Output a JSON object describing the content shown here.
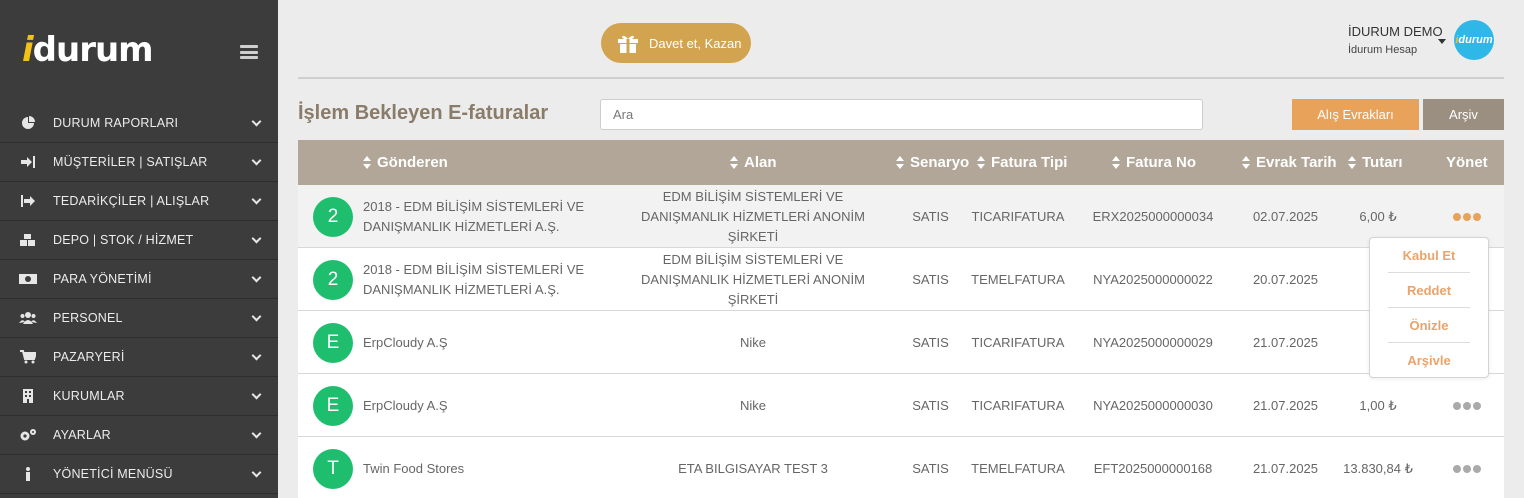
{
  "sidebar": {
    "logo_prefix": "i",
    "logo_rest": "durum",
    "items": [
      {
        "label": "DURUM RAPORLARI",
        "icon": "pie-chart-icon"
      },
      {
        "label": "MÜŞTERİLER | SATIŞLAR",
        "icon": "sign-in-icon"
      },
      {
        "label": "TEDARİKÇİLER | ALIŞLAR",
        "icon": "sign-out-icon"
      },
      {
        "label": "DEPO | STOK / HİZMET",
        "icon": "cubes-icon"
      },
      {
        "label": "PARA YÖNETİMİ",
        "icon": "money-icon"
      },
      {
        "label": "PERSONEL",
        "icon": "users-icon"
      },
      {
        "label": "PAZARYERİ",
        "icon": "cart-icon"
      },
      {
        "label": "KURUMLAR",
        "icon": "building-icon"
      },
      {
        "label": "AYARLAR",
        "icon": "cogs-icon"
      },
      {
        "label": "YÖNETİCİ MENÜSÜ",
        "icon": "info-icon"
      }
    ]
  },
  "header": {
    "invite_label": "Davet et, Kazan",
    "user_name": "İDURUM DEMO",
    "user_sub": "İdurum Hesap",
    "avatar_prefix": "i",
    "avatar_rest": "durum"
  },
  "page": {
    "title": "İşlem Bekleyen E-faturalar",
    "search_placeholder": "Ara",
    "btn_alis": "Alış Evrakları",
    "btn_arsiv": "Arşiv"
  },
  "table": {
    "columns": {
      "sender": "Gönderen",
      "alan": "Alan",
      "senaryo": "Senaryo",
      "tip": "Fatura Tipi",
      "no": "Fatura No",
      "tarih": "Evrak Tarih",
      "tutar": "Tutarı",
      "yonet": "Yönet"
    },
    "rows": [
      {
        "initial": "2",
        "sender": "2018 - EDM BİLİŞİM SİSTEMLERİ VE DANIŞMANLIK HİZMETLERİ A.Ş.",
        "alan": "EDM BİLİŞİM SİSTEMLERİ VE DANIŞMANLIK HİZMETLERİ ANONİM ŞİRKETİ",
        "senaryo": "SATIS",
        "tip": "TICARIFATURA",
        "no": "ERX2025000000034",
        "tarih": "02.07.2025",
        "tutar": "6,00 ₺"
      },
      {
        "initial": "2",
        "sender": "2018 - EDM BİLİŞİM SİSTEMLERİ VE DANIŞMANLIK HİZMETLERİ A.Ş.",
        "alan": "EDM BİLİŞİM SİSTEMLERİ VE DANIŞMANLIK HİZMETLERİ ANONİM ŞİRKETİ",
        "senaryo": "SATIS",
        "tip": "TEMELFATURA",
        "no": "NYA2025000000022",
        "tarih": "20.07.2025",
        "tutar": "33,"
      },
      {
        "initial": "E",
        "sender": "ErpCloudy A.Ş",
        "alan": "Nike",
        "senaryo": "SATIS",
        "tip": "TICARIFATURA",
        "no": "NYA2025000000029",
        "tarih": "21.07.2025",
        "tutar": "1,0"
      },
      {
        "initial": "E",
        "sender": "ErpCloudy A.Ş",
        "alan": "Nike",
        "senaryo": "SATIS",
        "tip": "TICARIFATURA",
        "no": "NYA2025000000030",
        "tarih": "21.07.2025",
        "tutar": "1,00 ₺"
      },
      {
        "initial": "T",
        "sender": "Twin Food Stores",
        "alan": "ETA BILGISAYAR TEST 3",
        "senaryo": "SATIS",
        "tip": "TEMELFATURA",
        "no": "EFT2025000000168",
        "tarih": "21.07.2025",
        "tutar": "13.830,84 ₺"
      }
    ]
  },
  "popup": {
    "items": [
      "Kabul Et",
      "Reddet",
      "Önizle",
      "Arşivle"
    ]
  },
  "colors": {
    "sidebar_bg": "#3c3c3c",
    "accent_orange": "#e9a259",
    "header_bar": "#b1a698",
    "avatar_green": "#1fbe6e",
    "invite_gold": "#d2a44f"
  }
}
